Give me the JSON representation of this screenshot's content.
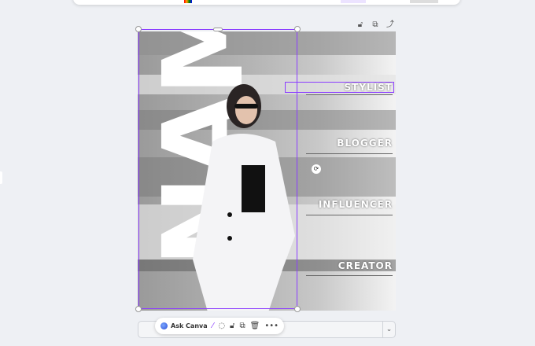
{
  "design": {
    "name_text": "NAME",
    "roles": [
      "STYLIST",
      "BLOGGER",
      "INFLUENCER",
      "CREATOR"
    ]
  },
  "canvas_actions": {
    "icons": [
      "lock-icon",
      "duplicate-icon",
      "add-page-icon"
    ]
  },
  "floating_toolbar": {
    "ask_label": "Ask Canva",
    "more": "•••"
  },
  "accent": "#8b3dff"
}
